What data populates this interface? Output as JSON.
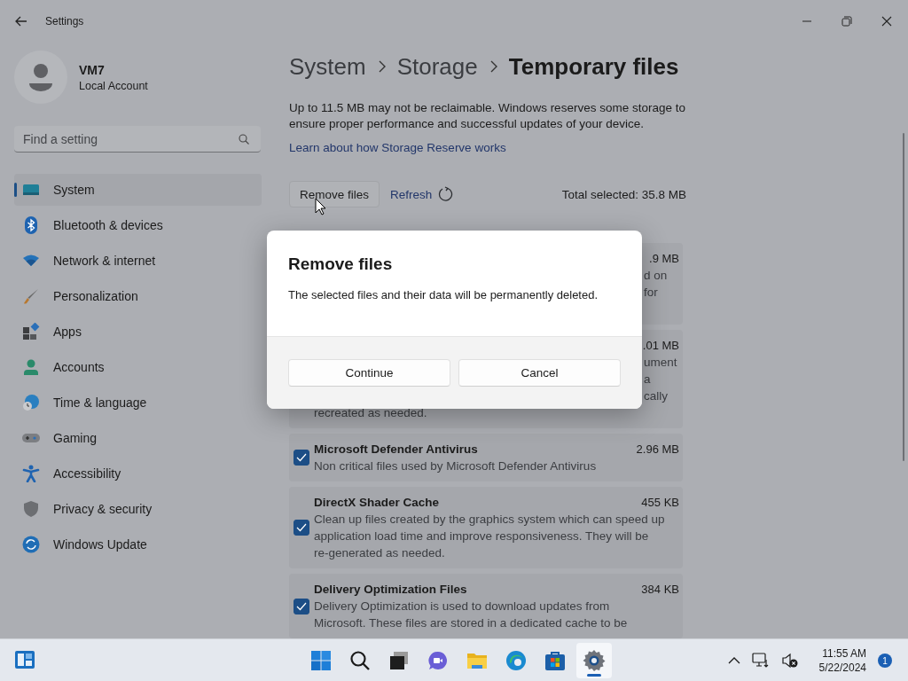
{
  "window": {
    "title": "Settings"
  },
  "account": {
    "name": "VM7",
    "type": "Local Account"
  },
  "search": {
    "placeholder": "Find a setting"
  },
  "nav": [
    {
      "label": "System",
      "kind": "system",
      "selected": true
    },
    {
      "label": "Bluetooth & devices",
      "kind": "bluetooth",
      "selected": false
    },
    {
      "label": "Network & internet",
      "kind": "network",
      "selected": false
    },
    {
      "label": "Personalization",
      "kind": "brush",
      "selected": false
    },
    {
      "label": "Apps",
      "kind": "apps",
      "selected": false
    },
    {
      "label": "Accounts",
      "kind": "accounts",
      "selected": false
    },
    {
      "label": "Time & language",
      "kind": "time",
      "selected": false
    },
    {
      "label": "Gaming",
      "kind": "gaming",
      "selected": false
    },
    {
      "label": "Accessibility",
      "kind": "accessibility",
      "selected": false
    },
    {
      "label": "Privacy & security",
      "kind": "privacy",
      "selected": false
    },
    {
      "label": "Windows Update",
      "kind": "update",
      "selected": false
    }
  ],
  "breadcrumb": [
    "System",
    "Storage",
    "Temporary files"
  ],
  "intro": "Up to 11.5 MB may not be reclaimable. Windows reserves some storage to ensure proper performance and successful updates of your device.",
  "link": "Learn about how Storage Reserve works",
  "actions": {
    "remove": "Remove files",
    "refresh": "Refresh",
    "total": "Total selected: 35.8 MB"
  },
  "items": [
    {
      "kind": "covered",
      "size": ".9 MB",
      "lines": [
        {
          "kind": "tail",
          "text": "d on"
        },
        {
          "kind": "tail",
          "text": "for"
        }
      ]
    },
    {
      "kind": "covered",
      "size": ".01 MB",
      "lines": [
        {
          "kind": "tail",
          "text": "ument"
        },
        {
          "kind": "tail",
          "text": "a"
        },
        {
          "kind": "tail",
          "text": "cally"
        },
        {
          "kind": "full",
          "text": "recreated as needed."
        }
      ]
    },
    {
      "kind": "item",
      "title": "Microsoft Defender Antivirus",
      "size": "2.96 MB",
      "checked": true,
      "lines": [
        {
          "kind": "full",
          "text": "Non critical files used by Microsoft Defender Antivirus"
        }
      ]
    },
    {
      "kind": "item",
      "title": "DirectX Shader Cache",
      "size": "455 KB",
      "checked": true,
      "lines": [
        {
          "kind": "full",
          "text": "Clean up files created by the graphics system which can speed up"
        },
        {
          "kind": "full",
          "text": "application load time and improve responsiveness. They will be"
        },
        {
          "kind": "full",
          "text": "re-generated as needed."
        }
      ]
    },
    {
      "kind": "item",
      "title": "Delivery Optimization Files",
      "size": "384 KB",
      "checked": true,
      "lines": [
        {
          "kind": "full",
          "text": "Delivery Optimization is used to download updates from"
        },
        {
          "kind": "full",
          "text": "Microsoft. These files are stored in a dedicated cache to be"
        }
      ]
    }
  ],
  "dialog": {
    "title": "Remove files",
    "message": "The selected files and their data will be permanently deleted.",
    "buttons": [
      "Continue",
      "Cancel"
    ]
  },
  "taskbar": {
    "apps": [
      {
        "kind": "start",
        "active": false
      },
      {
        "kind": "search",
        "active": false
      },
      {
        "kind": "taskview",
        "active": false
      },
      {
        "kind": "chat",
        "active": false
      },
      {
        "kind": "explorer",
        "active": false
      },
      {
        "kind": "edge",
        "active": false
      },
      {
        "kind": "store",
        "active": false
      },
      {
        "kind": "settings",
        "active": true
      }
    ],
    "time": "11:55 AM",
    "date": "5/22/2024",
    "notifications": "1"
  }
}
